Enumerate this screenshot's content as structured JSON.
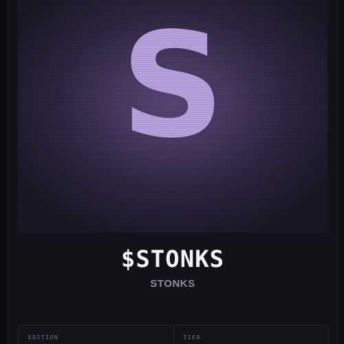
{
  "artwork": {
    "letter": "S"
  },
  "token": {
    "ticker": "$STONKS",
    "name": "STONKS"
  },
  "details": {
    "edition_label": "EDITION",
    "tier_label": "TIER"
  },
  "colors": {
    "background": "#0d0c12",
    "card": "#131219",
    "accent": "#b9a3df",
    "ticker_text": "#f3f1f7",
    "muted_text": "#8f8b99"
  }
}
